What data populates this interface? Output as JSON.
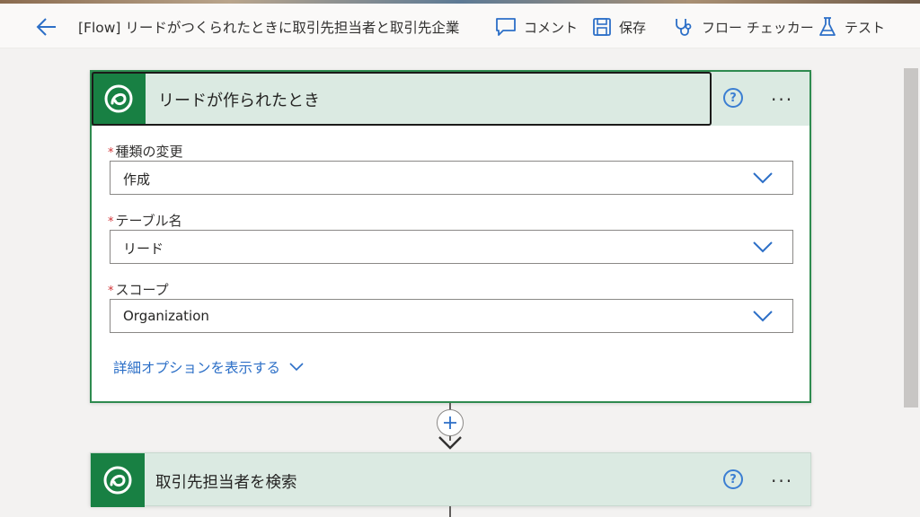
{
  "header": {
    "flow_title": "[Flow] リードがつくられたときに取引先担当者と取引先企業",
    "commands": [
      {
        "label": "コメント",
        "icon": "comment-icon"
      },
      {
        "label": "保存",
        "icon": "save-icon"
      },
      {
        "label": "フロー チェッカー",
        "icon": "stethoscope-icon"
      },
      {
        "label": "テスト",
        "icon": "flask-icon"
      }
    ]
  },
  "trigger": {
    "title": "リードが作られたとき",
    "fields": [
      {
        "label": "種類の変更",
        "value": "作成",
        "required_mark": "*"
      },
      {
        "label": "テーブル名",
        "value": "リード",
        "required_mark": "*"
      },
      {
        "label": "スコープ",
        "value": "Organization",
        "required_mark": "*"
      }
    ],
    "advanced_link": "詳細オプションを表示する",
    "help_glyph": "?",
    "more_glyph": "···"
  },
  "action": {
    "title": "取引先担当者を検索",
    "help_glyph": "?",
    "more_glyph": "···"
  },
  "colors": {
    "accent_green": "#188043",
    "card_border": "#2e8b4f",
    "header_bg": "#dbeae2",
    "link_blue": "#2c6fc7",
    "required_red": "#d13438"
  }
}
